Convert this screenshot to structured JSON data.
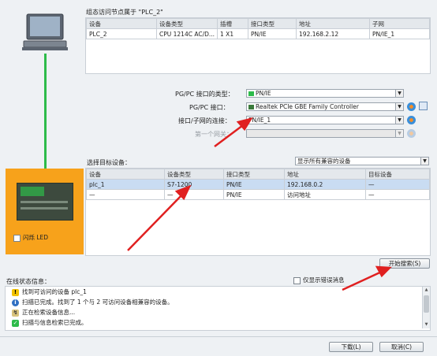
{
  "top": {
    "heading": "组态访问节点属于 \"PLC_2\"",
    "columns": [
      "设备",
      "设备类型",
      "插槽",
      "接口类型",
      "地址",
      "子网"
    ],
    "row": [
      "PLC_2",
      "CPU 1214C AC/D...",
      "1 X1",
      "PN/IE",
      "192.168.2.12",
      "PN/IE_1"
    ]
  },
  "interface": {
    "pgpc_type_label": "PG/PC 接口的类型：",
    "pgpc_type_value": "PN/IE",
    "pgpc_label": "PG/PC 接口：",
    "pgpc_value": "Realtek PCIe GBE Family Controller",
    "conn_label": "接口/子网的连接：",
    "conn_value": "PN/IE_1",
    "gateway_label": "第一个网关：",
    "gateway_value": ""
  },
  "target": {
    "label": "选择目标设备：",
    "filter_value": "显示所有兼容的设备",
    "columns": [
      "设备",
      "设备类型",
      "接口类型",
      "地址",
      "目标设备"
    ],
    "rows": [
      [
        "plc_1",
        "S7-1200",
        "PN/IE",
        "192.168.0.2",
        "—"
      ],
      [
        "—",
        "—",
        "PN/IE",
        "访问地址",
        "—"
      ]
    ]
  },
  "left_panel": {
    "flash_led_label": "闪烁 LED"
  },
  "search_button": "开始搜索(S)",
  "status": {
    "label": "在线状态信息：",
    "only_errors_label": "仅显示错误消息",
    "messages": [
      "找到可访问的设备 plc_1",
      "扫描已完成。找到了 1 个与 2 可访问设备相兼容的设备。",
      "正在检索设备信息...",
      "扫描与信息检索已完成。"
    ]
  },
  "footer": {
    "load_button": "下载(L)",
    "cancel_button": "取消(C)"
  },
  "colors": {
    "orange": "#f7a21b",
    "link_green": "#2dbb4a",
    "selected_row": "#c9dcf2",
    "arrow_red": "#e02020"
  }
}
